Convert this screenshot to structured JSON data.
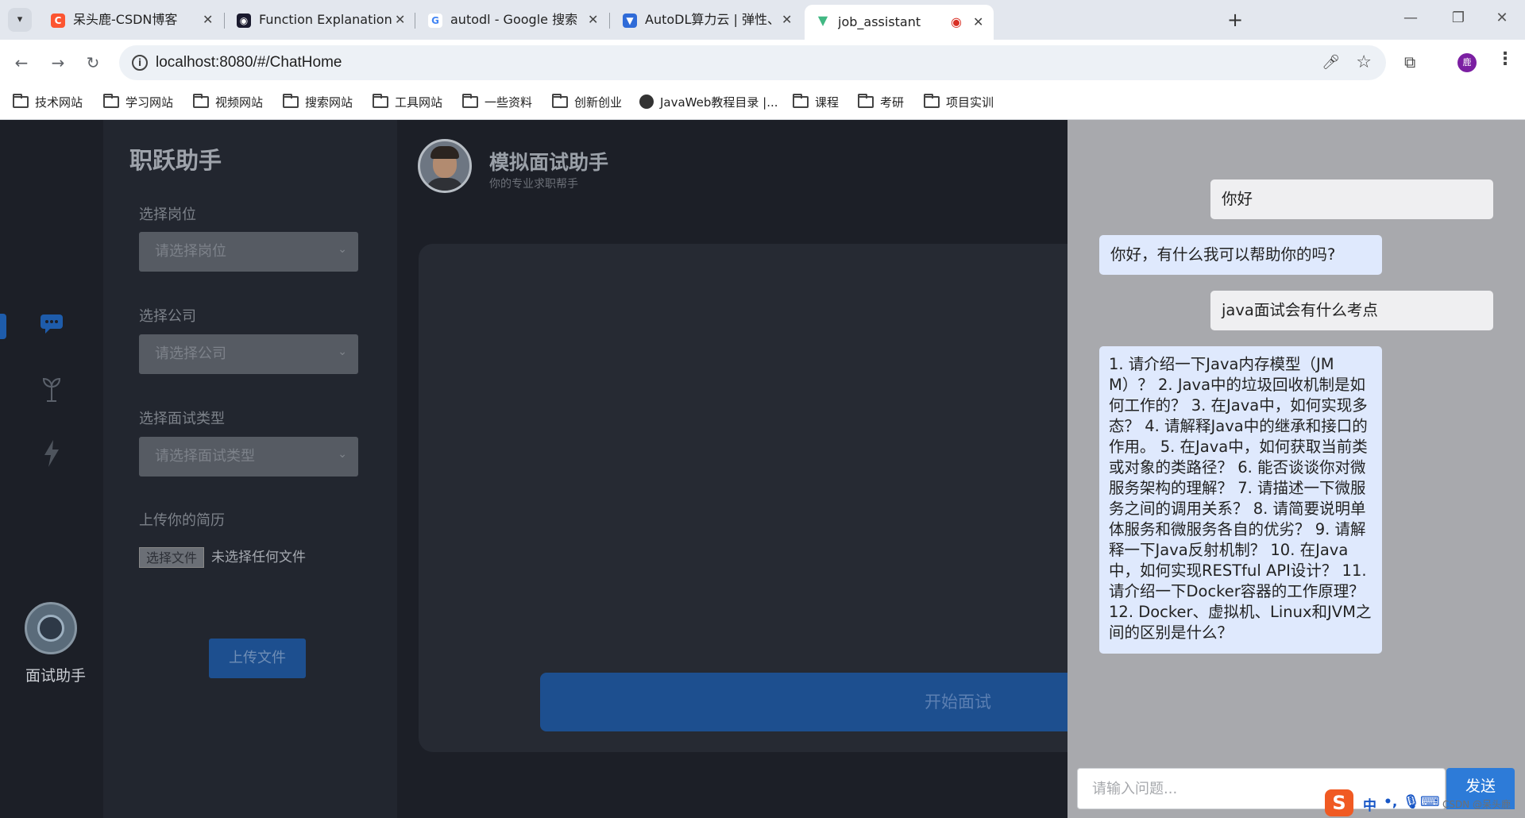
{
  "browser": {
    "tabs": [
      {
        "title": "呆头鹿-CSDN博客",
        "favicon": "csdn-icon",
        "color": "#fc5531"
      },
      {
        "title": "Function Explanation - Poe",
        "favicon": "poe-icon",
        "color": "#1a1a2e"
      },
      {
        "title": "autodl - Google 搜索",
        "favicon": "google-icon",
        "color": "#4285f4"
      },
      {
        "title": "AutoDL算力云 | 弹性、好用、",
        "favicon": "autodl-icon",
        "color": "#2f6bd8"
      },
      {
        "title": "job_assistant",
        "favicon": "vue-icon",
        "color": "#41b883"
      }
    ],
    "active_tab_index": 4,
    "address": "localhost:8080/#/ChatHome",
    "profile_initial": "鹿",
    "bookmarks": [
      {
        "label": "技术网站",
        "icon": "folder-icon"
      },
      {
        "label": "学习网站",
        "icon": "folder-icon"
      },
      {
        "label": "视频网站",
        "icon": "folder-icon"
      },
      {
        "label": "搜索网站",
        "icon": "folder-icon"
      },
      {
        "label": "工具网站",
        "icon": "folder-icon"
      },
      {
        "label": "一些资料",
        "icon": "folder-icon"
      },
      {
        "label": "创新创业",
        "icon": "folder-icon"
      },
      {
        "label": "JavaWeb教程目录 |...",
        "icon": "globe-icon"
      },
      {
        "label": "课程",
        "icon": "folder-icon"
      },
      {
        "label": "考研",
        "icon": "folder-icon"
      },
      {
        "label": "项目实训",
        "icon": "folder-icon"
      }
    ]
  },
  "sidebar": {
    "icons": [
      "chat-icon",
      "sprout-icon",
      "lightning-icon"
    ],
    "active_index": 0,
    "bot_label": "面试助手",
    "accent": "#1e5cab"
  },
  "form": {
    "brand": "职跃助手",
    "position_label": "选择岗位",
    "position_placeholder": "请选择岗位",
    "company_label": "选择公司",
    "company_placeholder": "请选择公司",
    "type_label": "选择面试类型",
    "type_placeholder": "请选择面试类型",
    "resume_label": "上传你的简历",
    "file_button": "选择文件",
    "file_status": "未选择任何文件",
    "upload_button": "上传文件"
  },
  "main": {
    "title": "模拟面试助手",
    "subtitle": "你的专业求职帮手",
    "start_button": "开始面试"
  },
  "chat": {
    "messages": [
      {
        "role": "user",
        "text": "你好"
      },
      {
        "role": "assistant",
        "text": "你好，有什么我可以帮助你的吗?"
      },
      {
        "role": "user",
        "text": "java面试会有什么考点"
      },
      {
        "role": "assistant",
        "text": "1. 请介绍一下Java内存模型（JMM）？ 2. Java中的垃圾回收机制是如何工作的？ 3. 在Java中，如何实现多态？ 4. 请解释Java中的继承和接口的作用。 5. 在Java中，如何获取当前类或对象的类路径？ 6. 能否谈谈你对微服务架构的理解？ 7. 请描述一下微服务之间的调用关系？ 8. 请简要说明单体服务和微服务各自的优劣？ 9. 请解释一下Java反射机制？ 10. 在Java中，如何实现RESTful API设计？ 11. 请介绍一下Docker容器的工作原理？ 12. Docker、虚拟机、Linux和JVM之间的区别是什么？"
      }
    ],
    "input_placeholder": "请输入问题...",
    "send_button": "发送"
  },
  "ime": {
    "logo": "S",
    "mode": "中",
    "watermark": "CSDN @呆头鹿"
  }
}
